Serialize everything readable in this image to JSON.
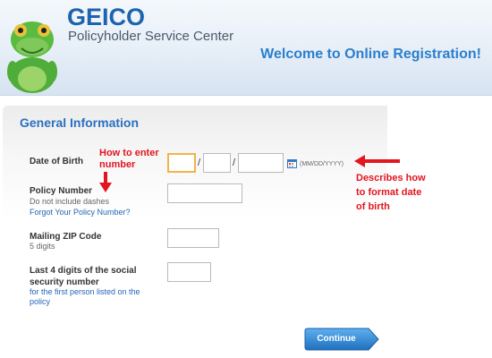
{
  "header": {
    "brand": "GEICO",
    "service_center": "Policyholder Service Center",
    "welcome": "Welcome to Online Registration!"
  },
  "section": {
    "title": "General Information"
  },
  "fields": {
    "dob": {
      "label": "Date of Birth",
      "separator": "/",
      "format_hint": "(MM/DD/YYYY)"
    },
    "policy": {
      "label": "Policy Number",
      "hint": "Do not include dashes",
      "forgot_link": "Forgot Your Policy Number?"
    },
    "zip": {
      "label": "Mailing ZIP Code",
      "hint": "5 digits"
    },
    "ssn": {
      "label_line1": "Last 4 digits of the social",
      "label_line2": "security number",
      "hint_line1": "for the first person listed on the",
      "hint_line2": "policy"
    }
  },
  "annotations": {
    "how_to_enter_1": "How to enter",
    "how_to_enter_2": "number",
    "describes_1": "Describes how",
    "describes_2": "to format date",
    "describes_3": "of birth"
  },
  "buttons": {
    "continue": "Continue"
  },
  "colors": {
    "brand_blue": "#1d63ae",
    "link_blue": "#2566b8",
    "annotation_red": "#e3151f",
    "button_blue": "#2a7ccc",
    "highlight_orange": "#f0b44a"
  },
  "icons": {
    "gecko": "gecko-mascot-icon",
    "calendar": "calendar-icon",
    "arrows": "red-arrow-icon"
  }
}
